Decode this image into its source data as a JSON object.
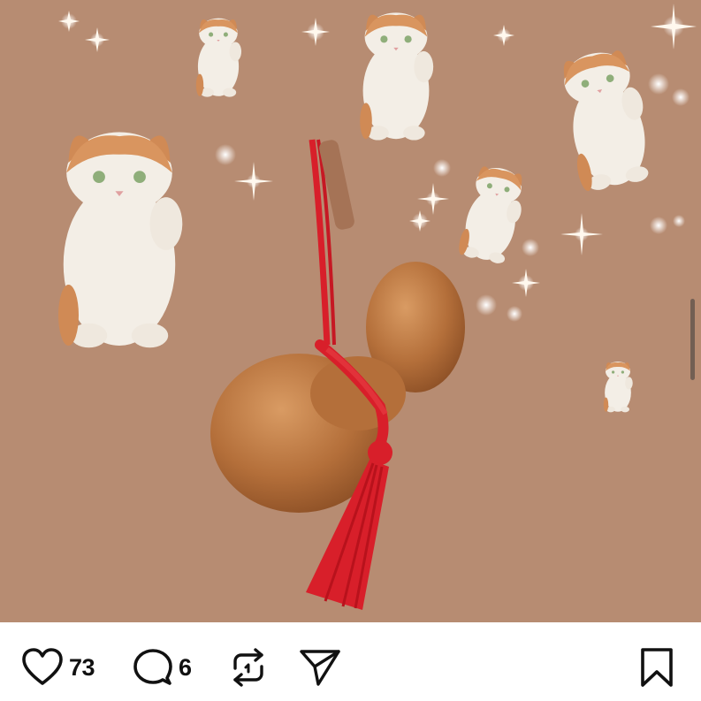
{
  "post": {
    "image": {
      "description_icon": "image-icon"
    },
    "actions": {
      "like": {
        "icon": "heart-icon",
        "count": "73"
      },
      "comment": {
        "icon": "comment-icon",
        "count": "6"
      },
      "repost": {
        "icon": "repost-icon"
      },
      "share": {
        "icon": "send-icon"
      },
      "save": {
        "icon": "bookmark-icon"
      }
    }
  },
  "colors": {
    "background": "#b78c72",
    "accent": "#d81f2a",
    "text": "#111111"
  }
}
